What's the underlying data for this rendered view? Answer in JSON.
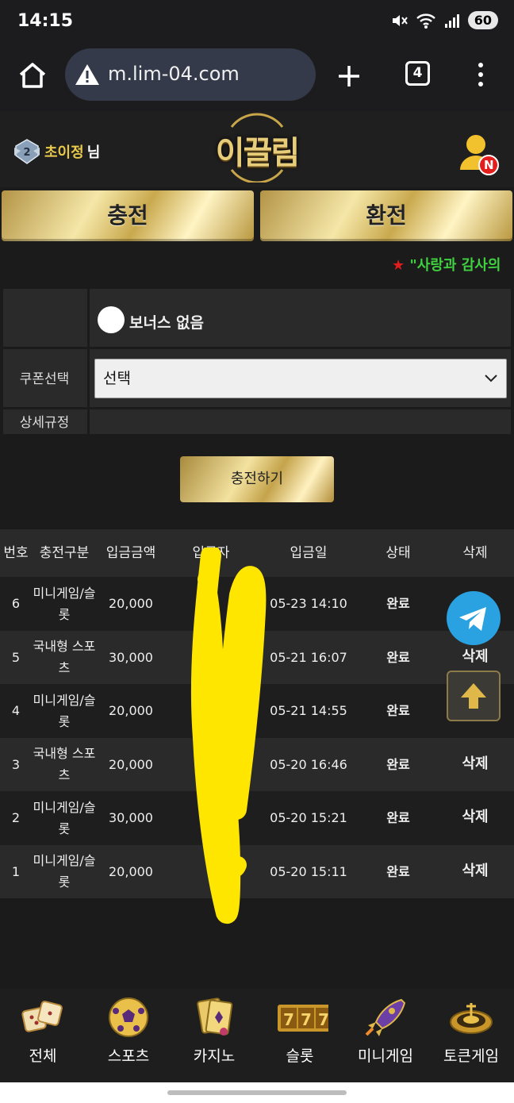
{
  "status_bar": {
    "time": "14:15",
    "battery": "60"
  },
  "browser": {
    "url": "m.lim-04.com",
    "tab_count": "4"
  },
  "header": {
    "user_name": "초이정",
    "user_suffix": "님",
    "logo_text": "이끌림",
    "notification_badge": "N"
  },
  "tabs": {
    "charge": "충전",
    "exchange": "환전"
  },
  "marquee": {
    "star": "★",
    "text": " \"사랑과 감사의"
  },
  "form": {
    "bonus_option": "보너스 없음",
    "coupon_label": "쿠폰선택",
    "coupon_selected": "선택",
    "rules_label": "상세규정",
    "submit": "충전하기"
  },
  "history": {
    "headers": [
      "번호",
      "충전구분",
      "입금금액",
      "입금자",
      "입금일",
      "상태",
      "삭제"
    ],
    "rows": [
      {
        "no": "6",
        "type": "미니게임/슬롯",
        "amount": "20,000",
        "depositor": "",
        "date": "05-23 14:10",
        "status": "완료",
        "delete": ""
      },
      {
        "no": "5",
        "type": "국내형 스포츠",
        "amount": "30,000",
        "depositor": "",
        "date": "05-21 16:07",
        "status": "완료",
        "delete": "삭제"
      },
      {
        "no": "4",
        "type": "미니게임/슬롯",
        "amount": "20,000",
        "depositor": "",
        "date": "05-21 14:55",
        "status": "완료",
        "delete": ""
      },
      {
        "no": "3",
        "type": "국내형 스포츠",
        "amount": "20,000",
        "depositor": "",
        "date": "05-20 16:46",
        "status": "완료",
        "delete": "삭제"
      },
      {
        "no": "2",
        "type": "미니게임/슬롯",
        "amount": "30,000",
        "depositor": "",
        "date": "05-20 15:21",
        "status": "완료",
        "delete": "삭제"
      },
      {
        "no": "1",
        "type": "미니게임/슬롯",
        "amount": "20,000",
        "depositor": "",
        "date": "05-20 15:11",
        "status": "완료",
        "delete": "삭제"
      }
    ]
  },
  "bottom_nav": [
    {
      "label": "전체",
      "icon": "dice-icon"
    },
    {
      "label": "스포츠",
      "icon": "soccer-ball-icon"
    },
    {
      "label": "카지노",
      "icon": "cards-icon"
    },
    {
      "label": "슬롯",
      "icon": "slot-777-icon"
    },
    {
      "label": "미니게임",
      "icon": "rocket-icon"
    },
    {
      "label": "토큰게임",
      "icon": "roulette-icon"
    }
  ],
  "colors": {
    "gold": "#e7cc7a",
    "marquee_green": "#3fd03f",
    "star_red": "#e21c1c",
    "telegram_blue": "#2aa1e0"
  }
}
